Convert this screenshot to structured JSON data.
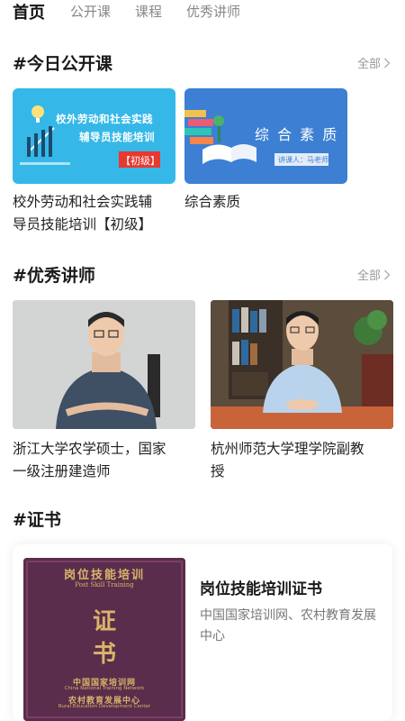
{
  "tabs": [
    {
      "label": "首页",
      "active": true
    },
    {
      "label": "公开课",
      "active": false
    },
    {
      "label": "课程",
      "active": false
    },
    {
      "label": "优秀讲师",
      "active": false
    }
  ],
  "sections": {
    "today": {
      "title": "#今日公开课",
      "see_all": "全部"
    },
    "teachers": {
      "title": "#优秀讲师",
      "see_all": "全部"
    },
    "certificate": {
      "title": "#证书"
    }
  },
  "courses": [
    {
      "thumb_line1": "校外劳动和社会实践",
      "thumb_line2": "辅导员技能培训",
      "thumb_badge": "【初级】",
      "title_line1": "校外劳动和社会实践辅",
      "title_line2": "导员技能培训【初级】"
    },
    {
      "thumb_title": "综 合 素 质",
      "thumb_sub": "讲课人：马老师",
      "title_line1": "综合素质"
    }
  ],
  "teachers": [
    {
      "desc_line1": "浙江大学农学硕士，国家",
      "desc_line2": "一级注册建造师"
    },
    {
      "desc_line1": "杭州师范大学理学院副教",
      "desc_line2": "授"
    }
  ],
  "certificate": {
    "title": "岗位技能培训证书",
    "issuer": "中国国家培训网、农村教育发展中心",
    "image_header": "岗位技能培训",
    "image_header_en": "Post Skill Training",
    "image_char1": "证",
    "image_char2": "书",
    "image_org1": "中国国家培训网",
    "image_org1_en": "China National Training Network",
    "image_org2": "农村教育发展中心",
    "image_org2_en": "Rural Education Development Center"
  },
  "colors": {
    "thumb1_bg": "#35b8e8",
    "thumb2_bg": "#3c7fd3",
    "badge_red": "#e8382f",
    "cert_cover": "#5b2d4c",
    "cert_gold": "#d8b56a"
  }
}
